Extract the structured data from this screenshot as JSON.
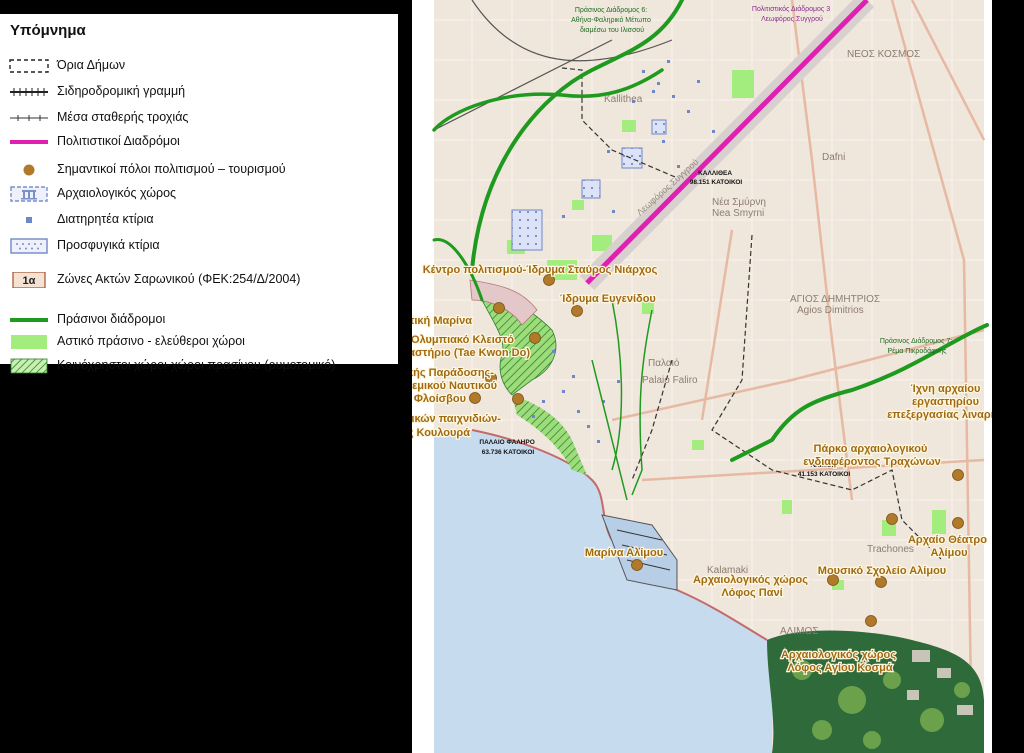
{
  "legend": {
    "title": "Υπόμνημα",
    "items": [
      {
        "key": "municipal-boundaries",
        "label": "Όρια Δήμων"
      },
      {
        "key": "railway-line",
        "label": "Σιδηροδρομική γραμμή"
      },
      {
        "key": "fixed-track-transport",
        "label": "Μέσα σταθερής τροχιάς"
      },
      {
        "key": "cultural-routes",
        "label": "Πολιτιστικοί Διαδρόμοι"
      },
      {
        "key": "culture-tourism-poles",
        "label": "Σημαντικοί πόλοι πολιτισμού – τουρισμού"
      },
      {
        "key": "archaeological-site",
        "label": "Αρχαιολογικός χώρος"
      },
      {
        "key": "preserved-buildings",
        "label": "Διατηρητέα κτίρια"
      },
      {
        "key": "refugee-buildings",
        "label": "Προσφυγικά κτίρια"
      },
      {
        "key": "saronic-zones",
        "label": "Ζώνες Ακτών Σαρωνικού (ΦΕΚ:254/Δ/2004)",
        "badge": "1α"
      },
      {
        "key": "green-routes",
        "label": "Πράσινοι διάδρομοι"
      },
      {
        "key": "urban-green",
        "label": "Αστικό πράσινο - ελεύθεροι χώροι"
      },
      {
        "key": "common-spaces",
        "label": "Κοινόχρηστοι χώροι-χώροι πρασίνου (ρυμοτομικό)"
      }
    ]
  },
  "map": {
    "routes": [
      {
        "key": "green-route-6",
        "text": [
          "Πράσινος Διάδρομος 6:",
          "Αθήνα-Φαληρικό Μέτωπο",
          "διαμέσω του Ιλισσού"
        ]
      },
      {
        "key": "cultural-route-3",
        "text": [
          "Πολιτιστικός Διάδρομος 3",
          "Λεωφόρος Συγγρού"
        ]
      },
      {
        "key": "green-route-7",
        "text": [
          "Πράσινος Διάδρομος 7:",
          "Ρέμα Πικροδάφνης"
        ]
      }
    ],
    "districts": [
      {
        "key": "kallithea",
        "lines": [
          "ΚΑΛΛΙΘΕΑ",
          "98.151 ΚΑΤΟΙΚΟΙ"
        ]
      },
      {
        "key": "palaio-faliro",
        "lines": [
          "ΠΑΛΑΙΟ ΦΑΛΗΡΟ",
          "63.736 ΚΑΤΟΙΚΟΙ"
        ]
      },
      {
        "key": "alimos",
        "lines": [
          "ΑΛΙΜΟΣ",
          "41.153 ΚΑΤΟΙΚΟΙ"
        ]
      }
    ],
    "places": [
      {
        "key": "snfcc",
        "lines": [
          "Κέντρο πολιτισμού-Ίδρυμα Σταύρος Νιάρχος"
        ]
      },
      {
        "key": "eugenides",
        "lines": [
          "Ίδρυμα Ευγενίδου"
        ]
      },
      {
        "key": "nautical-marina",
        "lines": [
          "Ναυταθλητική Μαρίνα"
        ]
      },
      {
        "key": "olympic-hall",
        "lines": [
          "Ολυμπιακό Κλειστό",
          "Γυμναστήριο (Tae Kwon Do)"
        ]
      },
      {
        "key": "naval-park",
        "lines": [
          "Πάρκο Ναυτικής Παράδοσης-",
          "Μουσείο Πολεμικού Ναυτικού"
        ]
      },
      {
        "key": "flisvos",
        "lines": [
          "Μαρίνα Φλοίσβου"
        ]
      },
      {
        "key": "toy-museum",
        "lines": [
          "Μουσείο παιδικών παιχνιδιών-",
          "Πύργος Κουλουρά"
        ]
      },
      {
        "key": "workshop",
        "lines": [
          "Ίχνη αρχαίου",
          "εργαστηρίου",
          "επεξεργασίας λιναριού"
        ]
      },
      {
        "key": "trachones-park",
        "lines": [
          "Πάρκο αρχαιολογικού",
          "ενδιαφέροντος Τραχώνων"
        ]
      },
      {
        "key": "theatre",
        "lines": [
          "Αρχαίο Θέατρο",
          "Αλίμου"
        ]
      },
      {
        "key": "marina-alimou",
        "lines": [
          "Μαρίνα Αλίμου"
        ]
      },
      {
        "key": "pani",
        "lines": [
          "Αρχαιολογικός χώρος",
          "Λόφος Πανί"
        ]
      },
      {
        "key": "music-school",
        "lines": [
          "Μουσικό Σχολείο Αλίμου"
        ]
      },
      {
        "key": "agios-kosmas",
        "lines": [
          "Αρχαιολογικός χώρος",
          "Λόφος Αγίου Κοσμά"
        ]
      }
    ],
    "base_labels": {
      "nea_smyrni": "Nea Smyrni",
      "nea_smyrni_gr": "Νέα Σμύρνη",
      "agios_dimitrios": "ΑΓΙΟΣ ΔΗΜΗΤΡΙΟΣ",
      "agios_dimitrios_lat": "Agios Dimitrios",
      "neos_kosmos": "ΝΕΟΣ ΚΟΣΜΟΣ",
      "kallithea_lat": "Kallithea",
      "dafni": "Dafni",
      "palaio": "Παλαιό",
      "faliro_lat": "Palaio Faliro",
      "alimos": "ΑΛΙΜΟΣ",
      "trachones": "Trachones",
      "kalamaki": "Kalamaki",
      "syngrou_road": "Λεωφόρος Συγγρού"
    }
  }
}
